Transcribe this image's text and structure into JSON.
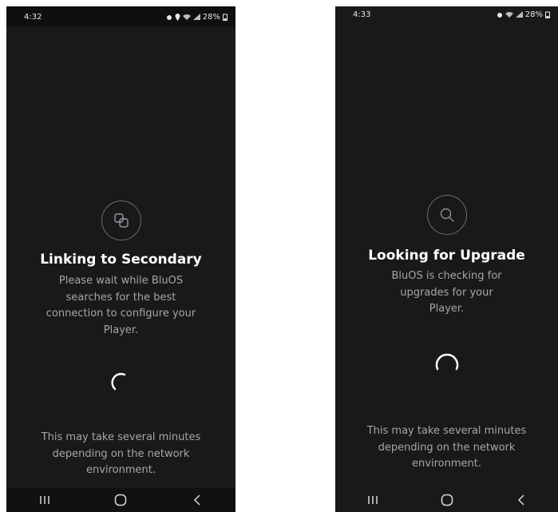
{
  "screens": [
    {
      "status": {
        "time": "4:32",
        "battery": "28%"
      },
      "icon": "link-squares-icon",
      "title": "Linking to Secondary",
      "description": "Please wait while BluOS searches for the best connection to configure your Player.",
      "footer": "This may take several minutes depending on the network environment."
    },
    {
      "status": {
        "time": "4:33",
        "battery": "28%"
      },
      "icon": "search-icon",
      "title": "Looking for Upgrade",
      "description": "BluOS is checking for upgrades for your Player.",
      "footer": "This may take several minutes depending on the network environment."
    }
  ],
  "navbar": {
    "icons": [
      "recent-apps-icon",
      "home-icon",
      "back-icon"
    ]
  },
  "colors": {
    "background": "#19191b",
    "text": "#ffffff",
    "muted_text": "#a6a6a9"
  }
}
